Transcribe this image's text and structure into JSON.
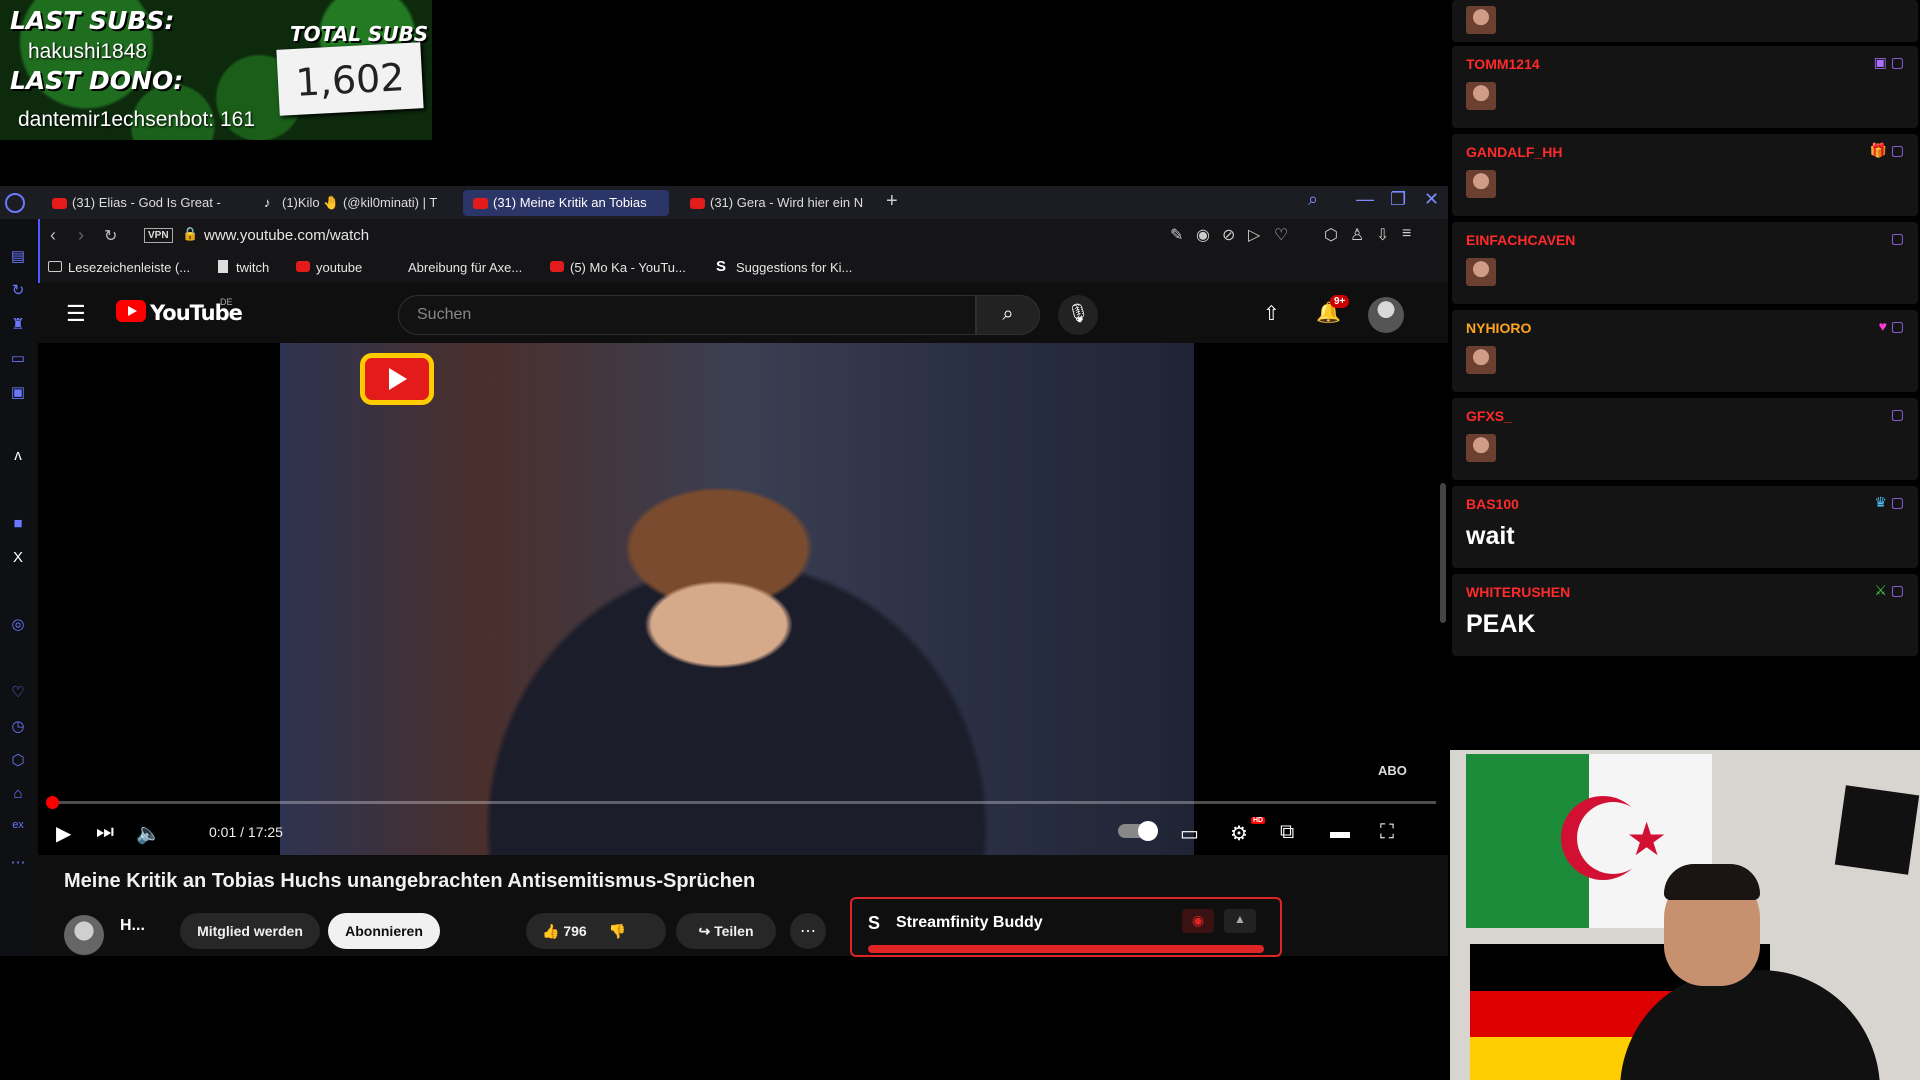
{
  "overlay": {
    "last_subs_label": "LAST SUBS:",
    "last_sub_user": "hakushi1848",
    "last_dono_label": "LAST DONO:",
    "last_dono_user": "dantemir1echsenbot: 161",
    "total_subs_label": "TOTAL SUBS",
    "total_subs_value": "1,602"
  },
  "browser": {
    "tabs": [
      {
        "label": "(31) Elias - God Is Great - ",
        "favicon": "youtube-icon"
      },
      {
        "label": "(1)Kilo 🤚 (@kil0minati) | T",
        "favicon": "tiktok-icon"
      },
      {
        "label": "(31) Meine Kritik an Tobias",
        "favicon": "youtube-icon",
        "active": true
      },
      {
        "label": "(31) Gera - Wird hier ein N",
        "favicon": "youtube-icon"
      }
    ],
    "vpn_label": "VPN",
    "url": "www.youtube.com/watch",
    "bookmarks": [
      {
        "label": "Lesezeichenleiste (...",
        "icon": "folder-icon"
      },
      {
        "label": "twitch",
        "icon": "file-icon"
      },
      {
        "label": "youtube",
        "icon": "youtube-icon"
      },
      {
        "label": "Abreibung für Axe...",
        "icon": "none"
      },
      {
        "label": "(5) Mo Ka - YouTu...",
        "icon": "youtube-icon"
      },
      {
        "label": "Suggestions for Ki...",
        "icon": "streamfinity-icon"
      }
    ]
  },
  "youtube": {
    "logo_text": "YouTube",
    "country": "DE",
    "search_placeholder": "Suchen",
    "notification_count": "9+",
    "video_time": "0:01 / 17:25",
    "video_progress": 0.001,
    "video_title": "Meine Kritik an Tobias Huchs unangebrachten Antisemitismus-Sprüchen",
    "channel_name": "H...",
    "join_label": "Mitglied werden",
    "subscribe_label": "Abonnieren",
    "like_count": "796",
    "share_label": "Teilen",
    "abo_watermark": "ABO"
  },
  "streamfinity": {
    "title": "Streamfinity Buddy"
  },
  "chat": {
    "messages": [
      {
        "user": "TOMM1214",
        "text": "",
        "emote": true,
        "user_color": "#ff2a2a"
      },
      {
        "user": "GANDALF_HH",
        "text": "",
        "emote": true,
        "user_color": "#ff2a2a"
      },
      {
        "user": "EINFACHCAVEN",
        "text": "",
        "emote": true,
        "user_color": "#ff2a2a"
      },
      {
        "user": "NYHIORO",
        "text": "",
        "emote": true,
        "user_color": "#ffa51f"
      },
      {
        "user": "GFXS_",
        "text": "",
        "emote": true,
        "user_color": "#ff2a2a"
      },
      {
        "user": "BAS100",
        "text": "wait",
        "emote": false,
        "user_color": "#ff2a2a"
      },
      {
        "user": "WHITERUSHEN",
        "text": "PEAK",
        "emote": false,
        "user_color": "#ff2a2a"
      }
    ]
  },
  "colors": {
    "accent": "#6a77ff",
    "youtube_red": "#ff0000",
    "chat_name_red": "#ff2a2a"
  }
}
